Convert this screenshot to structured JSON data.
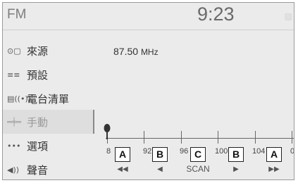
{
  "header": {
    "source": "FM",
    "clock": "9:23"
  },
  "sidebar": {
    "items": [
      {
        "icon": "⊙▢",
        "label": "來源"
      },
      {
        "icon": "≡≡",
        "label": "預設"
      },
      {
        "icon": "▤((•))",
        "label": "電台清單"
      },
      {
        "icon": "═╪═",
        "label": "手動"
      },
      {
        "icon": "•••",
        "label": "選項"
      },
      {
        "icon": "◀))",
        "label": "聲音"
      }
    ]
  },
  "main": {
    "frequency": "87.50",
    "frequency_unit": "MHz",
    "scale_labels": [
      "8",
      "92",
      "96",
      "100",
      "104",
      "08"
    ],
    "tuned_frequency": 87.5
  },
  "controls": [
    {
      "badge": "A",
      "symbol": "◀◀"
    },
    {
      "badge": "B",
      "symbol": "◀"
    },
    {
      "badge": "C",
      "symbol": "SCAN"
    },
    {
      "badge": "B",
      "symbol": "▶"
    },
    {
      "badge": "A",
      "symbol": "▶▶"
    }
  ]
}
